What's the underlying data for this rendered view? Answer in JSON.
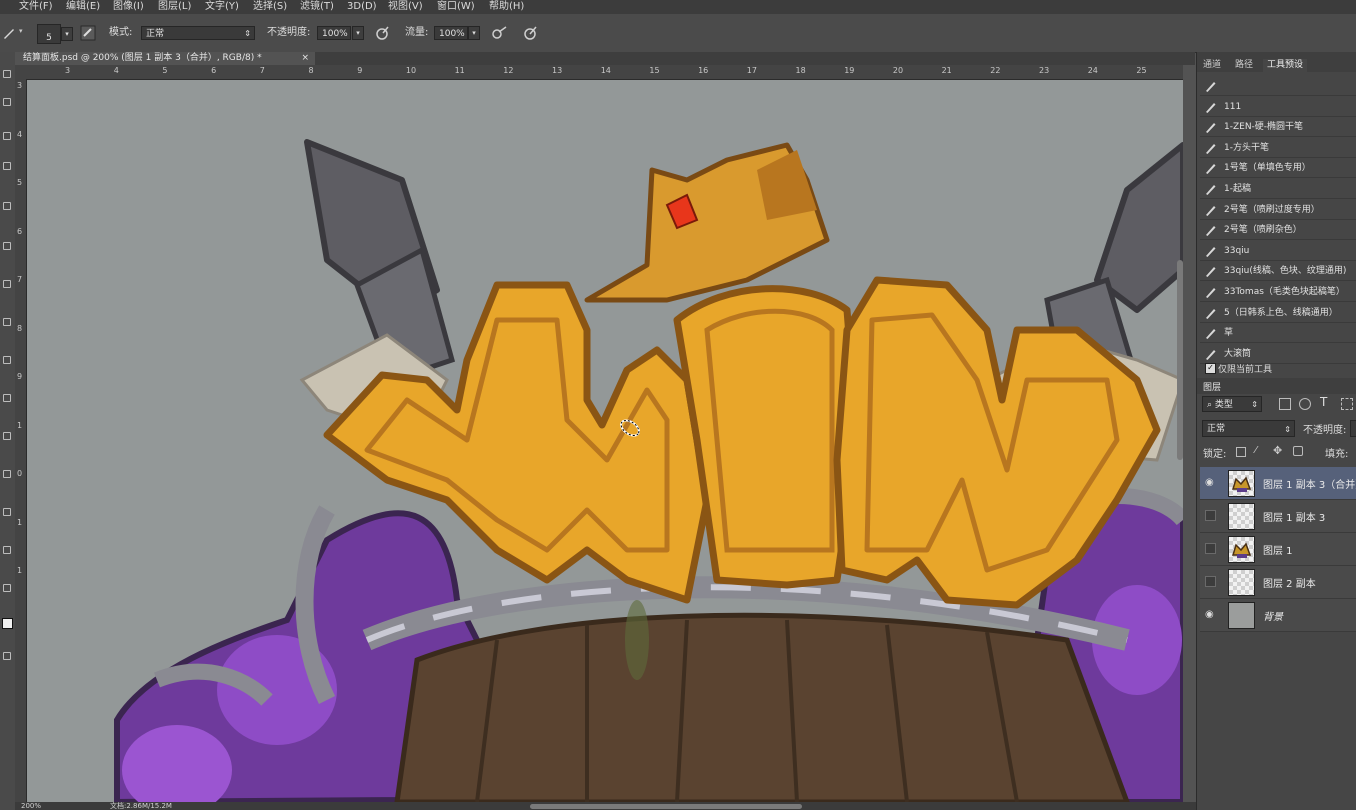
{
  "menu": [
    "文件(F)",
    "编辑(E)",
    "图像(I)",
    "图层(L)",
    "文字(Y)",
    "选择(S)",
    "滤镜(T)",
    "3D(D)",
    "视图(V)",
    "窗口(W)",
    "帮助(H)"
  ],
  "options": {
    "brush_size": "5",
    "mode_label": "模式:",
    "mode_value": "正常",
    "opacity_label": "不透明度:",
    "opacity_value": "100%",
    "flow_label": "流量:",
    "flow_value": "100%"
  },
  "document_tab": {
    "title": "结算面板.psd @ 200% (图层 1 副本 3（合并）, RGB/8) *",
    "close": "×"
  },
  "ruler": {
    "horizontal": [
      "3",
      "4",
      "5",
      "6",
      "7",
      "8",
      "9",
      "10",
      "11",
      "12",
      "13",
      "14",
      "15",
      "16",
      "17",
      "18",
      "19",
      "20",
      "21",
      "22",
      "23",
      "24",
      "25"
    ],
    "vertical": [
      "3",
      "4",
      "5",
      "6",
      "7",
      "8",
      "9",
      "1",
      "0",
      "1",
      "1"
    ]
  },
  "status": {
    "zoom": "200%",
    "doc_info": "文档:2.86M/15.2M"
  },
  "right_panel": {
    "tabs": [
      "通道",
      "路径",
      "工具预设"
    ],
    "active_tab": "工具预设",
    "tool_presets": [
      "",
      "111",
      "1-ZEN-硬-椭圆干笔",
      "1-方头干笔",
      "1号笔（单填色专用）",
      "1-起稿",
      "2号笔（喷刷过度专用）",
      "2号笔（喷刷杂色）",
      "33qiu",
      "33qiu(线稿、色块、纹理通用)",
      "33Tomas（毛类色块起稿笔）",
      "5（日韩系上色、线稿通用）",
      "草",
      "大滚筒"
    ],
    "current_tool_only_label": "仅限当前工具",
    "current_tool_only_checked": true
  },
  "layers_panel": {
    "title": "图层",
    "filter_kind": "类型",
    "blend_mode": "正常",
    "opacity_label": "不透明度:",
    "lock_label": "锁定:",
    "fill_label": "填充:",
    "layers": [
      {
        "name": "图层 1 副本 3（合并）",
        "visible": true,
        "selected": true,
        "thumb": "art"
      },
      {
        "name": "图层 1 副本 3",
        "visible": false,
        "selected": false,
        "thumb": "transparent"
      },
      {
        "name": "图层 1",
        "visible": false,
        "selected": false,
        "thumb": "art"
      },
      {
        "name": "图层 2 副本",
        "visible": false,
        "selected": false,
        "thumb": "transparent"
      },
      {
        "name": "背景",
        "visible": true,
        "selected": false,
        "thumb": "gray"
      }
    ]
  },
  "colors": {
    "canvas_bg": "#939898",
    "gold": "#e8a62a",
    "purple": "#7a3fb0",
    "wood": "#5a4330"
  }
}
